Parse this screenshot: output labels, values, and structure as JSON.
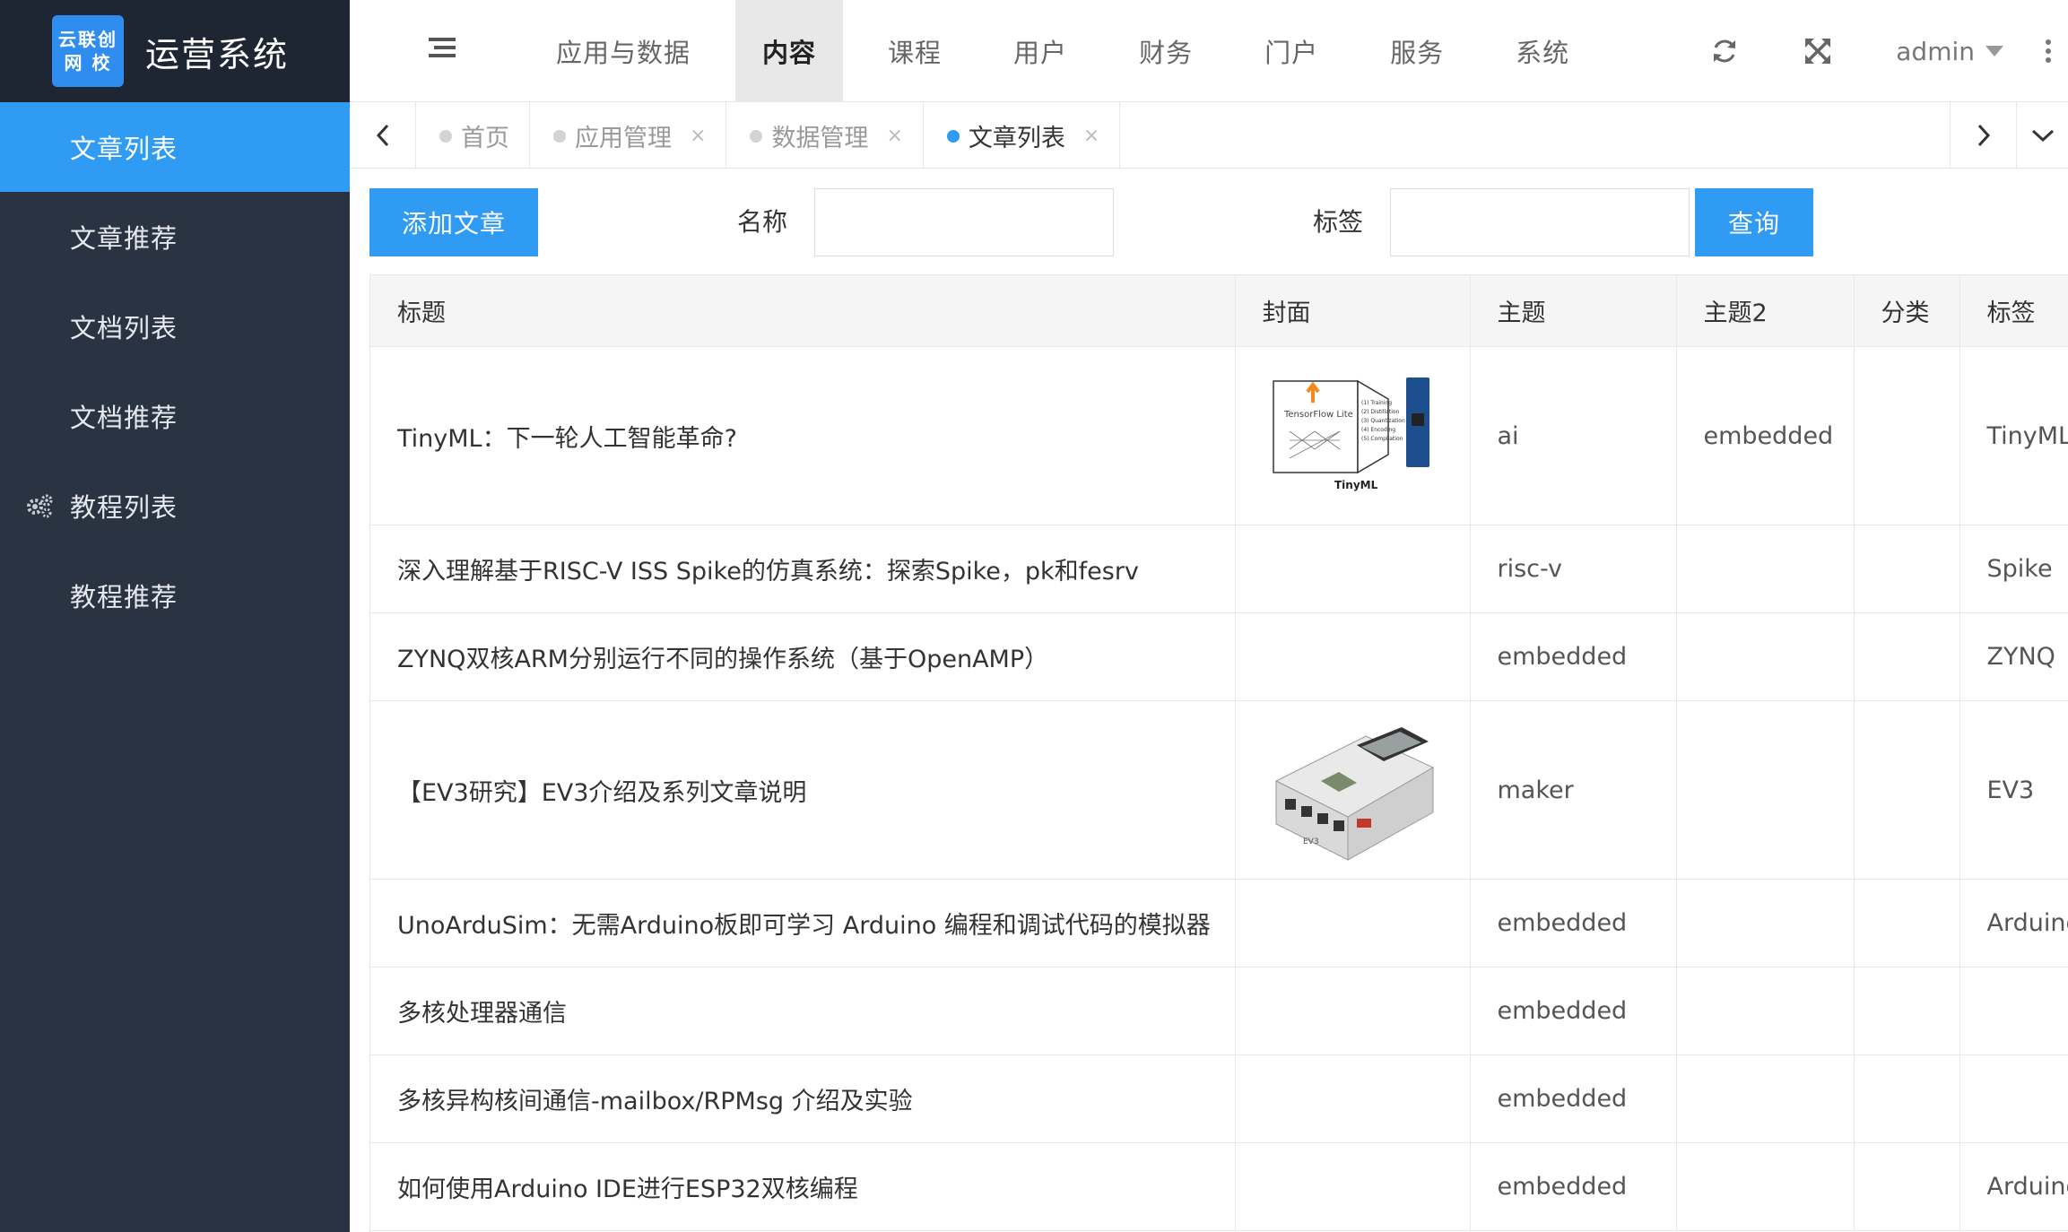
{
  "brand": {
    "logo_line1": "云联创",
    "logo_line2": "网 校",
    "title": "运营系统"
  },
  "sidebar": {
    "items": [
      {
        "label": "文章列表",
        "active": true
      },
      {
        "label": "文章推荐"
      },
      {
        "label": "文档列表"
      },
      {
        "label": "文档推荐"
      },
      {
        "label": "教程列表",
        "icon": "gears-icon"
      },
      {
        "label": "教程推荐"
      }
    ]
  },
  "topnav": {
    "items": [
      "应用与数据",
      "内容",
      "课程",
      "用户",
      "财务",
      "门户",
      "服务",
      "系统"
    ],
    "active": "内容"
  },
  "header": {
    "user": "admin"
  },
  "tabs": {
    "items": [
      {
        "label": "首页",
        "closable": false
      },
      {
        "label": "应用管理",
        "closable": true
      },
      {
        "label": "数据管理",
        "closable": true
      },
      {
        "label": "文章列表",
        "closable": true,
        "active": true
      }
    ],
    "close_glyph": "×"
  },
  "toolbar": {
    "add_label": "添加文章",
    "name_label": "名称",
    "name_value": "",
    "tag_label": "标签",
    "tag_value": "",
    "query_label": "查询"
  },
  "table": {
    "columns": [
      "标题",
      "封面",
      "主题",
      "主题2",
      "分类",
      "标签"
    ],
    "rows": [
      {
        "title": "TinyML：下一轮人工智能革命?",
        "cover": "tinyml",
        "topic": "ai",
        "topic2": "embedded",
        "category": "",
        "tag": "TinyML"
      },
      {
        "title": "深入理解基于RISC-V ISS Spike的仿真系统：探索Spike，pk和fesrv",
        "cover": "",
        "topic": "risc-v",
        "topic2": "",
        "category": "",
        "tag": "Spike"
      },
      {
        "title": "ZYNQ双核ARM分别运行不同的操作系统（基于OpenAMP）",
        "cover": "",
        "topic": "embedded",
        "topic2": "",
        "category": "",
        "tag": "ZYNQ"
      },
      {
        "title": "【EV3研究】EV3介绍及系列文章说明",
        "cover": "ev3",
        "topic": "maker",
        "topic2": "",
        "category": "",
        "tag": "EV3"
      },
      {
        "title": "UnoArduSim：无需Arduino板即可学习 Arduino 编程和调试代码的模拟器",
        "cover": "",
        "topic": "embedded",
        "topic2": "",
        "category": "",
        "tag": "Arduino"
      },
      {
        "title": "多核处理器通信",
        "cover": "",
        "topic": "embedded",
        "topic2": "",
        "category": "",
        "tag": ""
      },
      {
        "title": "多核异构核间通信-mailbox/RPMsg 介绍及实验",
        "cover": "",
        "topic": "embedded",
        "topic2": "",
        "category": "",
        "tag": ""
      },
      {
        "title": "如何使用Arduino IDE进行ESP32双核编程",
        "cover": "",
        "topic": "embedded",
        "topic2": "",
        "category": "",
        "tag": "Arduino"
      }
    ]
  },
  "covers": {
    "tinyml_lines": [
      "TensorFlow Lite",
      "TinyML",
      "(1) Training",
      "(2) Distillation",
      "(3) Quantization",
      "(4) Encoding",
      "(5) Compilation"
    ],
    "ev3_label": "EV3"
  },
  "colors": {
    "sidebar_bg": "#2a3342",
    "accent": "#2f9bf3",
    "logo_bg": "#1f2633"
  }
}
